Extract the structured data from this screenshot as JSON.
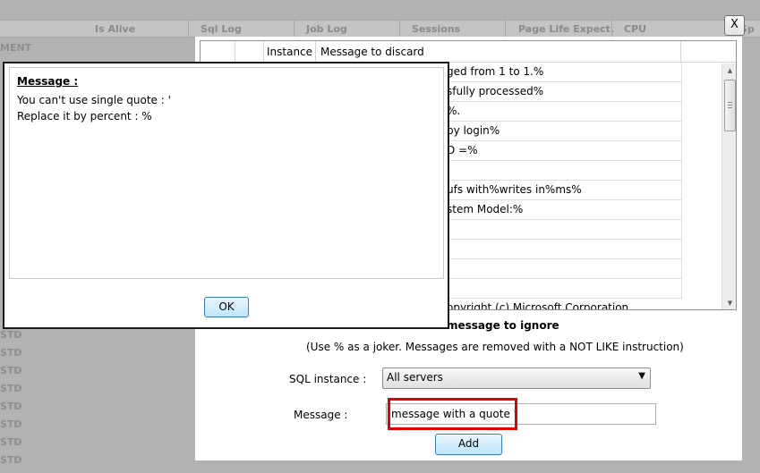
{
  "background": {
    "columns": [
      "Is Alive",
      "Sql Log",
      "Job Log",
      "Sessions",
      "Page Life Expect.",
      "CPU",
      "x Sp"
    ],
    "rows": [
      "MENT",
      "STD",
      "STD",
      "STD",
      "STD",
      "STD",
      "STD",
      "STD",
      "STD"
    ]
  },
  "dialog": {
    "close_label": "X",
    "grid": {
      "headers": [
        "Instance",
        "Message to discard"
      ],
      "rows": [
        "ged from 1 to 1.%",
        "sfully processed%",
        "%.",
        "by login%",
        "D =%",
        "",
        "ufs with%writes in%ms%",
        "stem Model:%",
        "",
        "",
        "",
        "",
        "opyright (c) Microsoft Corporation"
      ]
    },
    "section_title": "message to ignore",
    "hint": "(Use % as a joker. Messages are removed with a NOT LIKE instruction)",
    "sql_instance": {
      "label": "SQL instance :",
      "value": "All servers"
    },
    "message": {
      "label": "Message :",
      "value": "message with a quote '"
    },
    "add_label": "Add"
  },
  "popup": {
    "title": "Message :",
    "line1": "You can't use single quote : '",
    "line2": "Replace it by percent : %",
    "ok_label": "OK"
  },
  "colors": {
    "highlight": "#e00000",
    "overlay": "#b3b3b3"
  }
}
